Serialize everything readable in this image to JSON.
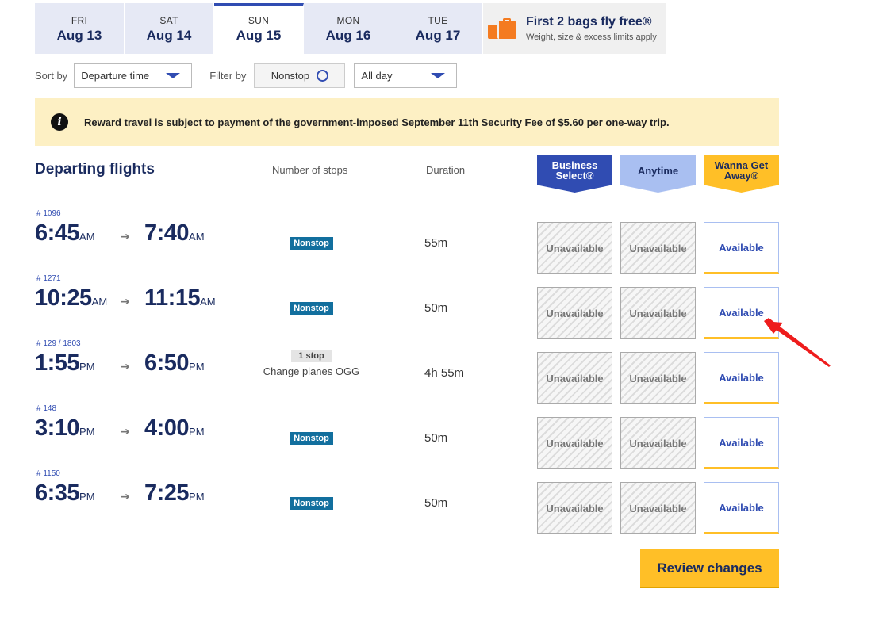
{
  "date_tabs": [
    {
      "dow": "FRI",
      "date": "Aug 13"
    },
    {
      "dow": "SAT",
      "date": "Aug 14"
    },
    {
      "dow": "SUN",
      "date": "Aug 15"
    },
    {
      "dow": "MON",
      "date": "Aug 16"
    },
    {
      "dow": "TUE",
      "date": "Aug 17"
    }
  ],
  "bags_promo": {
    "title": "First 2 bags fly free®",
    "subtitle": "Weight, size & excess limits apply",
    "icon": "suitcase-icon"
  },
  "controls": {
    "sort_label": "Sort by",
    "sort_value": "Departure time",
    "filter_label": "Filter by",
    "nonstop_label": "Nonstop",
    "time_filter_value": "All day"
  },
  "notice": {
    "text": "Reward travel is subject to payment of the government-imposed September 11th Security Fee of $5.60 per one-way trip."
  },
  "table_header": {
    "title": "Departing flights",
    "stops": "Number of stops",
    "duration": "Duration",
    "fare_business": "Business Select®",
    "fare_anytime": "Anytime",
    "fare_wga": "Wanna Get Away®"
  },
  "flights": [
    {
      "number": "# 1096",
      "dep_time": "6:45",
      "dep_ampm": "AM",
      "arr_time": "7:40",
      "arr_ampm": "AM",
      "stops": "Nonstop",
      "stop_detail": "",
      "duration": "55m",
      "business": "Unavailable",
      "anytime": "Unavailable",
      "wga": "Available"
    },
    {
      "number": "# 1271",
      "dep_time": "10:25",
      "dep_ampm": "AM",
      "arr_time": "11:15",
      "arr_ampm": "AM",
      "stops": "Nonstop",
      "stop_detail": "",
      "duration": "50m",
      "business": "Unavailable",
      "anytime": "Unavailable",
      "wga": "Available"
    },
    {
      "number": "# 129 / 1803",
      "dep_time": "1:55",
      "dep_ampm": "PM",
      "arr_time": "6:50",
      "arr_ampm": "PM",
      "stops": "1 stop",
      "stop_detail": "Change planes OGG",
      "duration": "4h 55m",
      "business": "Unavailable",
      "anytime": "Unavailable",
      "wga": "Available"
    },
    {
      "number": "# 148",
      "dep_time": "3:10",
      "dep_ampm": "PM",
      "arr_time": "4:00",
      "arr_ampm": "PM",
      "stops": "Nonstop",
      "stop_detail": "",
      "duration": "50m",
      "business": "Unavailable",
      "anytime": "Unavailable",
      "wga": "Available"
    },
    {
      "number": "# 1150",
      "dep_time": "6:35",
      "dep_ampm": "PM",
      "arr_time": "7:25",
      "arr_ampm": "PM",
      "stops": "Nonstop",
      "stop_detail": "",
      "duration": "50m",
      "business": "Unavailable",
      "anytime": "Unavailable",
      "wga": "Available"
    }
  ],
  "review_button": "Review changes",
  "colors": {
    "brand_blue": "#304cb2",
    "navy": "#1a2b5f",
    "yellow": "#ffbf27",
    "anytime_blue": "#a9bff1",
    "notice_bg": "#fdf0c4",
    "annotation_red": "#ee1c1c"
  }
}
